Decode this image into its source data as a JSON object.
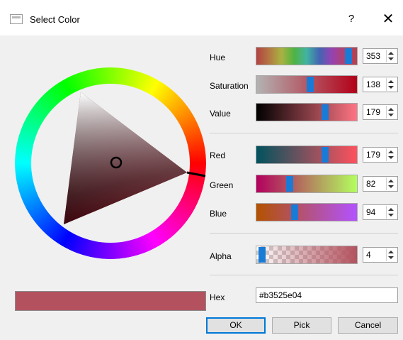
{
  "window": {
    "title": "Select Color",
    "help_label": "?",
    "close_label": "✕"
  },
  "hsv": [
    {
      "label": "Hue",
      "value": "353",
      "handle": 0.95
    },
    {
      "label": "Saturation",
      "value": "138",
      "handle": 0.54
    },
    {
      "label": "Value",
      "value": "179",
      "handle": 0.7
    }
  ],
  "rgb": [
    {
      "label": "Red",
      "value": "179",
      "handle": 0.7
    },
    {
      "label": "Green",
      "value": "82",
      "handle": 0.32
    },
    {
      "label": "Blue",
      "value": "94",
      "handle": 0.37
    }
  ],
  "alpha": {
    "label": "Alpha",
    "value": "4",
    "handle": 0.02
  },
  "hex": {
    "label": "Hex",
    "value": "#b3525e04"
  },
  "buttons": {
    "ok": "OK",
    "pick": "Pick",
    "cancel": "Cancel"
  },
  "colors": {
    "selected": "#b3525e",
    "accent": "#1a7bd7",
    "titlebar": "#ffffff",
    "window_bg": "#f0f0f0"
  }
}
